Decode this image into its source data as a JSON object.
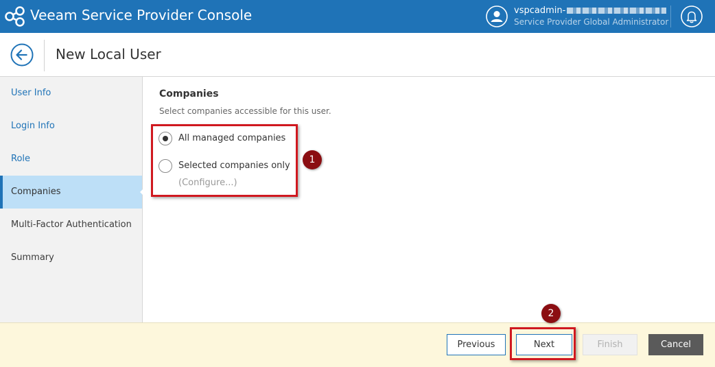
{
  "app": {
    "title": "Veeam Service Provider Console",
    "user_name": "vspcadmin-",
    "user_role": "Service Provider Global Administrator"
  },
  "header": {
    "title": "New Local User"
  },
  "sidebar": {
    "items": [
      {
        "label": "User Info"
      },
      {
        "label": "Login Info"
      },
      {
        "label": "Role"
      },
      {
        "label": "Companies"
      },
      {
        "label": "Multi-Factor Authentication"
      },
      {
        "label": "Summary"
      }
    ],
    "active_index": 3
  },
  "main": {
    "section_title": "Companies",
    "section_desc": "Select companies accessible for this user.",
    "options": [
      {
        "label": "All managed companies",
        "checked": true
      },
      {
        "label": "Selected companies only",
        "checked": false
      }
    ],
    "configure_label": "(Configure...)"
  },
  "annotations": {
    "marker_1": "1",
    "marker_2": "2",
    "highlight_color": "#d0181f",
    "marker_color": "#8b0e12"
  },
  "footer": {
    "previous_label": "Previous",
    "next_label": "Next",
    "finish_label": "Finish",
    "cancel_label": "Cancel"
  },
  "colors": {
    "brand": "#1f73b7",
    "active_nav": "#bddff7",
    "footer_bg": "#fdf7dc"
  },
  "icons": {
    "logo": "veeam-logo-icon",
    "user": "user-avatar-icon",
    "notifications": "bell-icon",
    "back": "back-arrow-icon"
  }
}
